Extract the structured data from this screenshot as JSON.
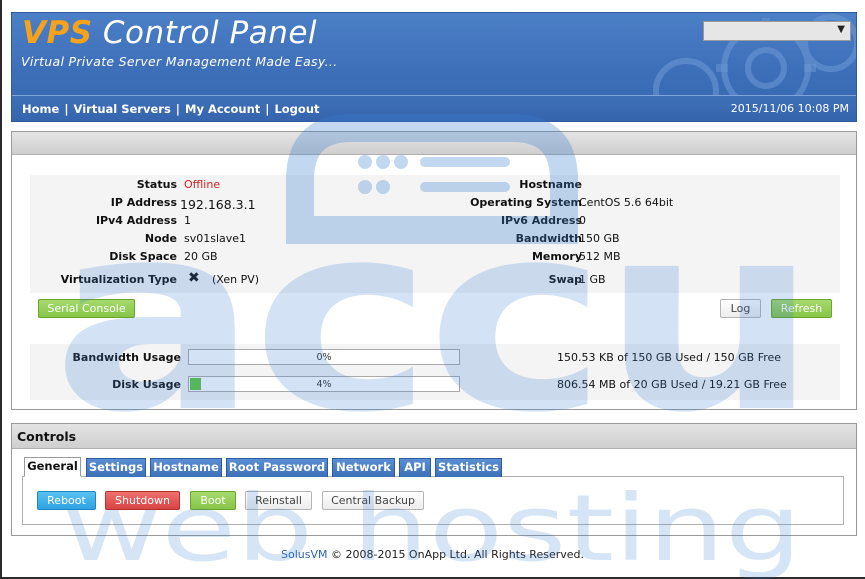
{
  "header": {
    "logo_accent": "VPS",
    "logo_text": "Control Panel",
    "tagline": "Virtual Private Server Management Made Easy...",
    "language_select_value": "",
    "datetime": "2015/11/06 10:08 PM"
  },
  "nav": {
    "items": [
      "Home",
      "Virtual Servers",
      "My Account",
      "Logout"
    ],
    "separator": "|"
  },
  "server_info": {
    "left": [
      {
        "label": "Status",
        "value": "Offline"
      },
      {
        "label": "IP Address",
        "value": "192.168.3.1"
      },
      {
        "label": "IPv4 Address",
        "value": "1"
      },
      {
        "label": "Node",
        "value": "sv01slave1"
      },
      {
        "label": "Disk Space",
        "value": "20 GB"
      },
      {
        "label": "Virtualization Type",
        "value": "(Xen PV)"
      }
    ],
    "right": [
      {
        "label": "Hostname",
        "value": ""
      },
      {
        "label": "Operating System",
        "value": "CentOS 5.6 64bit"
      },
      {
        "label": "IPv6 Address",
        "value": "0"
      },
      {
        "label": "Bandwidth",
        "value": "150 GB"
      },
      {
        "label": "Memory",
        "value": "512 MB"
      },
      {
        "label": "Swap",
        "value": "1 GB"
      }
    ],
    "buttons": {
      "serial_console": "Serial Console",
      "log": "Log",
      "refresh": "Refresh"
    }
  },
  "usage": [
    {
      "label": "Bandwidth Usage",
      "percent_text": "0%",
      "percent": 0,
      "detail": "150.53 KB of 150 GB Used / 150 GB Free"
    },
    {
      "label": "Disk Usage",
      "percent_text": "4%",
      "percent": 4,
      "detail": "806.54 MB of 20 GB Used / 19.21 GB Free"
    }
  ],
  "controls": {
    "title": "Controls",
    "tabs": [
      "General",
      "Settings",
      "Hostname",
      "Root Password",
      "Network",
      "API",
      "Statistics"
    ],
    "active_tab": "General",
    "buttons": {
      "reboot": "Reboot",
      "shutdown": "Shutdown",
      "boot": "Boot",
      "reinstall": "Reinstall",
      "central_backup": "Central Backup"
    }
  },
  "footer": {
    "link": "SolusVM",
    "text": "© 2008-2015 OnApp Ltd. All Rights Reserved."
  },
  "watermark": {
    "word1": "accu",
    "word2": "web hosting"
  },
  "colors": {
    "header_blue": "#3d6fb9",
    "logo_orange": "#f7a21b",
    "offline_red": "#d02020",
    "usage_green": "#5ec63f",
    "watermark_blue": "#3a7fd0"
  }
}
